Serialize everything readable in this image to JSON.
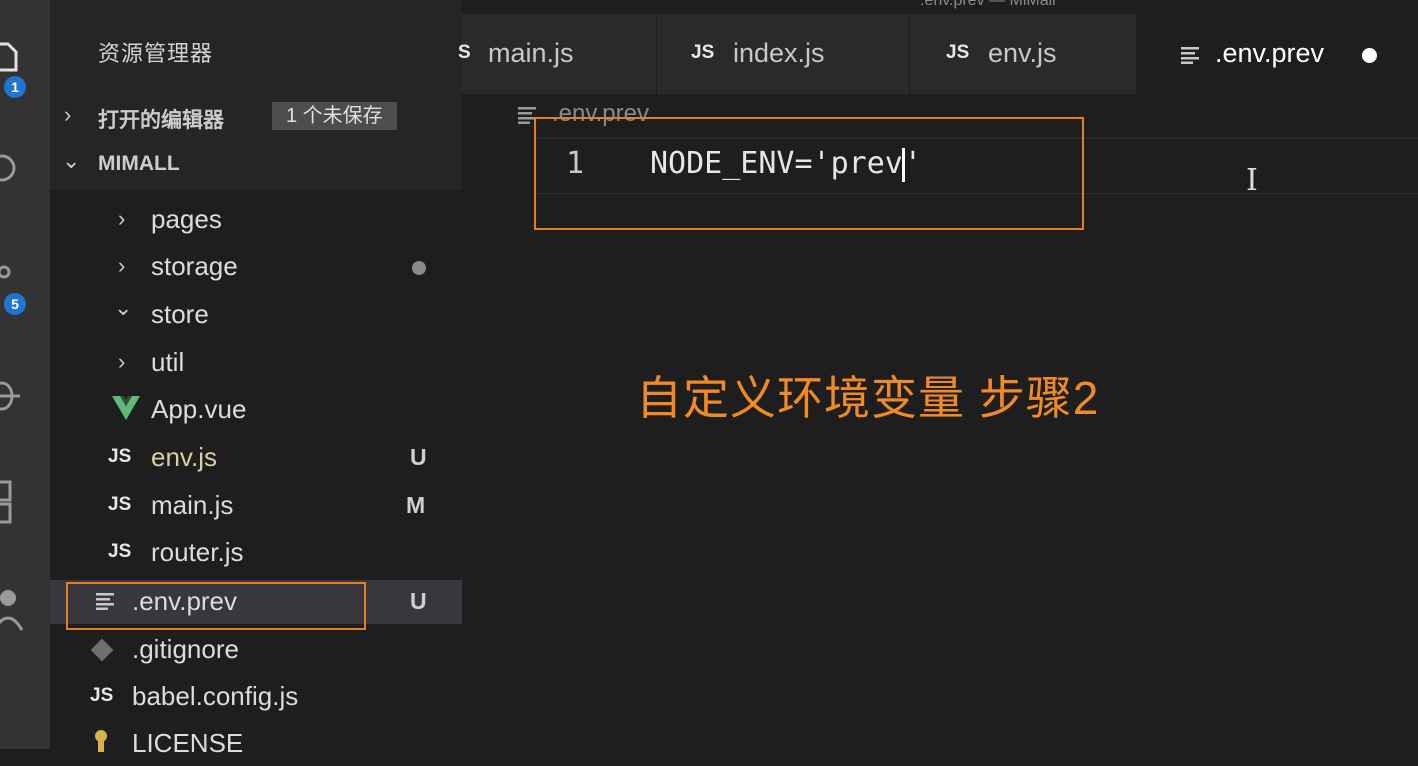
{
  "window": {
    "title": ".env.prev — MiMall"
  },
  "activity_bar": {
    "explorer_badge": "1",
    "scm_badge": "5"
  },
  "sidebar": {
    "title": "资源管理器",
    "open_editors": {
      "label": "打开的编辑器",
      "badge": "1 个未保存"
    },
    "project": {
      "label": "MIMALL"
    },
    "tree": [
      {
        "label": "pages",
        "kind": "folder",
        "expanded": false,
        "status": ""
      },
      {
        "label": "storage",
        "kind": "folder",
        "expanded": false,
        "status": "dot"
      },
      {
        "label": "store",
        "kind": "folder",
        "expanded": true,
        "status": ""
      },
      {
        "label": "util",
        "kind": "folder",
        "expanded": false,
        "status": ""
      },
      {
        "label": "App.vue",
        "kind": "vue",
        "status": ""
      },
      {
        "label": "env.js",
        "kind": "js",
        "icon_text": "JS",
        "status": "U"
      },
      {
        "label": "main.js",
        "kind": "js",
        "icon_text": "JS",
        "status": "M"
      },
      {
        "label": "router.js",
        "kind": "js",
        "icon_text": "JS",
        "status": ""
      },
      {
        "label": ".env.prev",
        "kind": "text",
        "status": "U",
        "selected": true
      },
      {
        "label": ".gitignore",
        "kind": "git",
        "status": ""
      },
      {
        "label": "babel.config.js",
        "kind": "js",
        "icon_text": "JS",
        "status": ""
      },
      {
        "label": "LICENSE",
        "kind": "license",
        "status": ""
      }
    ]
  },
  "tabs": [
    {
      "icon_text": "S",
      "label": "main.js"
    },
    {
      "icon_text": "JS",
      "label": "index.js"
    },
    {
      "icon_text": "JS",
      "label": "env.js"
    },
    {
      "icon_text": "",
      "label": ".env.prev",
      "active": true,
      "dirty": true
    }
  ],
  "editor": {
    "breadcrumb": ".env.prev",
    "line_number": "1",
    "code_before_cursor": "NODE_ENV='prev",
    "code_after_cursor": "'"
  },
  "annotation": "自定义环境变量 步骤2",
  "colors": {
    "highlight_border": "#e67e22",
    "annotation": "#f08a24",
    "badge": "#1f75cf"
  },
  "icons": [
    "files-icon",
    "search-icon",
    "source-control-icon",
    "debug-icon",
    "extensions-icon",
    "account-icon"
  ]
}
